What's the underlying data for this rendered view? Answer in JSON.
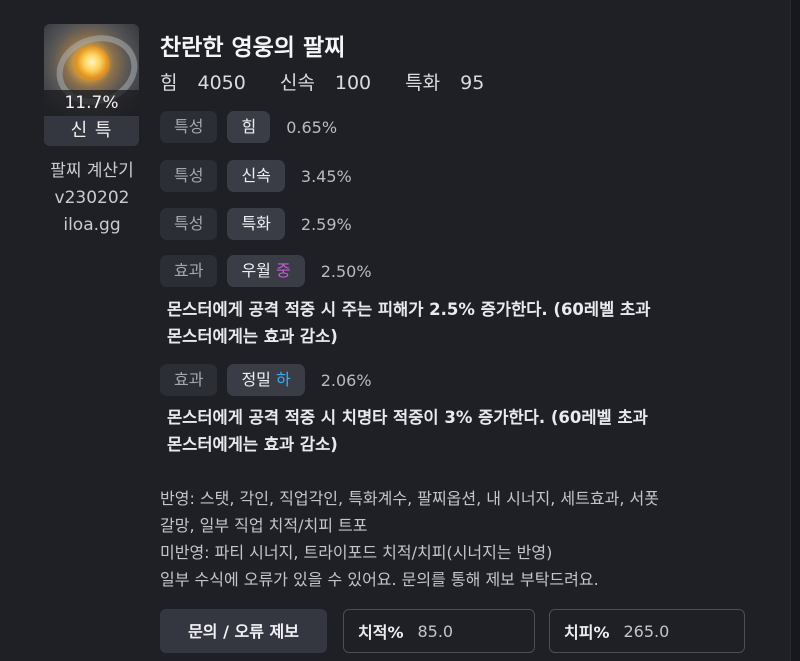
{
  "item": {
    "quality_percent": "11.7%",
    "tier": "신 특",
    "name": "찬란한 영웅의 팔찌"
  },
  "sidebar": {
    "app_name": "팔찌 계산기",
    "version": "v230202",
    "site": "iloa.gg"
  },
  "base_stats": [
    {
      "name": "힘",
      "value": "4050"
    },
    {
      "name": "신속",
      "value": "100"
    },
    {
      "name": "특화",
      "value": "95"
    }
  ],
  "options": [
    {
      "kind": "특성",
      "name": "힘",
      "value": "0.65%"
    },
    {
      "kind": "특성",
      "name": "신속",
      "value": "3.45%"
    },
    {
      "kind": "특성",
      "name": "특화",
      "value": "2.59%"
    },
    {
      "kind": "효과",
      "name": "우월",
      "grade": "중",
      "grade_color": "#c85ad8",
      "value": "2.50%",
      "description": [
        "몬스터에게 공격 적중 시 주는 피해가 2.5% 증가한다. (60레벨 초과",
        "몬스터에게는 효과 감소)"
      ]
    },
    {
      "kind": "효과",
      "name": "정밀",
      "grade": "하",
      "grade_color": "#3fa9ee",
      "value": "2.06%",
      "description": [
        "몬스터에게 공격 적중 시 치명타 적중이 3% 증가한다. (60레벨 초과",
        "몬스터에게는 효과 감소)"
      ]
    }
  ],
  "notes": [
    "반영: 스탯, 각인, 직업각인, 특화계수, 팔찌옵션, 내 시너지, 세트효과, 서폿",
    "갈망, 일부 직업 치적/치피 트포",
    "미반영: 파티 시너지, 트라이포드 치적/치피(시너지는 반영)",
    "일부 수식에 오류가 있을 수 있어요. 문의를 통해 제보 부탁드려요."
  ],
  "footer": {
    "report_button": "문의 / 오류 제보",
    "crit_rate": {
      "label": "치적%",
      "value": "85.0"
    },
    "crit_damage": {
      "label": "치피%",
      "value": "265.0"
    }
  },
  "colors": {
    "background": "#17181c",
    "panel": "#1f2025",
    "chip_kind": "#2c2e35",
    "chip_name": "#3a3d45",
    "grade_mid": "#c85ad8",
    "grade_low": "#3fa9ee"
  }
}
